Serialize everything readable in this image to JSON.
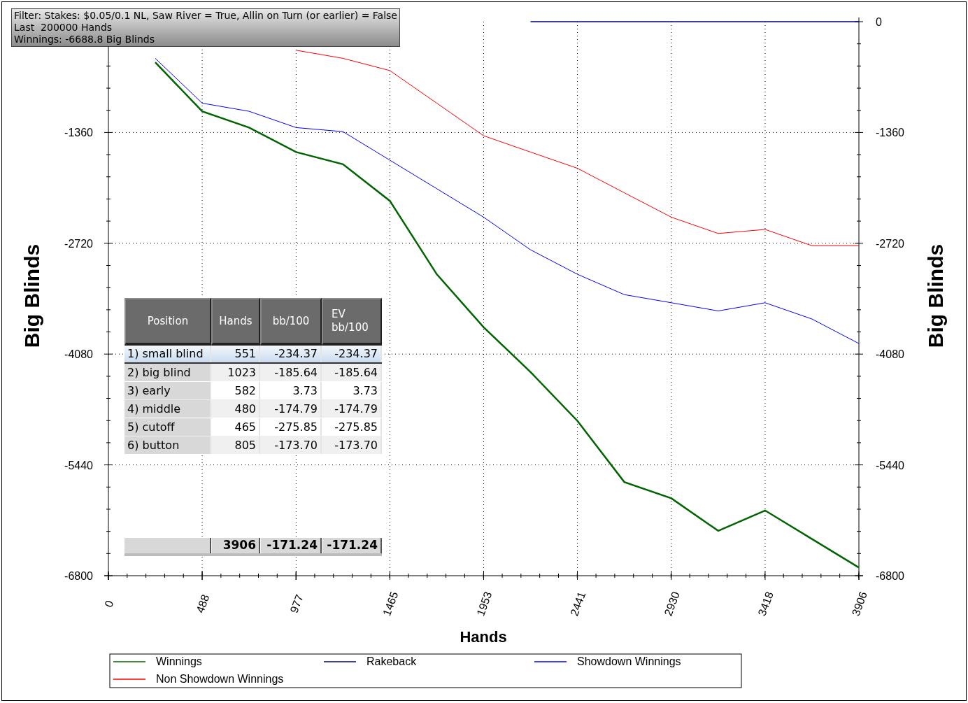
{
  "filter_box": {
    "lines": [
      "Filter: Stakes: $0.05/0.1 NL, Saw River = True, Allin on Turn (or earlier) = False",
      "Last  200000 Hands",
      "Winnings: -6688.8 Big Blinds"
    ]
  },
  "chart": {
    "ylabel_right": "Big Blinds",
    "left_axis_labels": [
      "-1360",
      "-2720",
      "-4080",
      "-5440",
      "-6800"
    ],
    "right_axis_labels": [
      "0",
      "-1360",
      "-2720",
      "-4080",
      "-5440",
      "-6800"
    ],
    "chart_data": {
      "type": "line",
      "xlabel": "Hands",
      "ylabel": "Big Blinds",
      "x": [
        244,
        488,
        732,
        977,
        1221,
        1465,
        1709,
        1953,
        2197,
        2441,
        2685,
        2930,
        3174,
        3418,
        3662,
        3906
      ],
      "xlim": [
        0,
        3906
      ],
      "ylim": [
        -6800,
        0
      ],
      "grid": true,
      "legend": true,
      "xticks": [
        0,
        488,
        977,
        1465,
        1953,
        2441,
        2930,
        3418,
        3906
      ],
      "yticks": [
        0,
        -1360,
        -2720,
        -4080,
        -5440,
        -6800
      ],
      "series": [
        {
          "name": "Winnings",
          "color": "#006400",
          "values": [
            -500,
            -1100,
            -1300,
            -1600,
            -1750,
            -2200,
            -3100,
            -3750,
            -4300,
            -4900,
            -5650,
            -5850,
            -6250,
            -6000,
            -6350,
            -6700
          ]
        },
        {
          "name": "Rakeback",
          "color": "#000080",
          "values": [
            null,
            null,
            null,
            null,
            null,
            null,
            null,
            null,
            0,
            0,
            0,
            0,
            0,
            0,
            0,
            0
          ]
        },
        {
          "name": "Showdown Winnings",
          "color": "#0000ff",
          "values": [
            -450,
            -1000,
            -1100,
            -1300,
            -1350,
            -1700,
            -2050,
            -2400,
            -2800,
            -3100,
            -3350,
            -3450,
            -3550,
            -3450,
            -3650,
            -3950
          ]
        },
        {
          "name": "Non Showdown Winnings",
          "color": "#ff0000",
          "values": [
            null,
            null,
            null,
            -350,
            -450,
            -600,
            -1000,
            -1400,
            -1600,
            -1800,
            -2100,
            -2400,
            -2600,
            -2550,
            -2750,
            -2750
          ]
        }
      ]
    }
  },
  "table": {
    "columns": [
      "Position",
      "Hands",
      "bb/100",
      "EV bb/100"
    ],
    "rows": [
      {
        "cells": [
          "1) small blind",
          "551",
          "-234.37",
          "-234.37"
        ],
        "selected": true
      },
      {
        "cells": [
          "2) big blind",
          "1023",
          "-185.64",
          "-185.64"
        ],
        "selected": false
      },
      {
        "cells": [
          "3) early",
          "582",
          "3.73",
          "3.73"
        ],
        "selected": false
      },
      {
        "cells": [
          "4) middle",
          "480",
          "-174.79",
          "-174.79"
        ],
        "selected": false
      },
      {
        "cells": [
          "5) cutoff",
          "465",
          "-275.85",
          "-275.85"
        ],
        "selected": false
      },
      {
        "cells": [
          "6) button",
          "805",
          "-173.70",
          "-173.70"
        ],
        "selected": false
      }
    ],
    "totals": [
      "3906",
      "-171.24",
      "-171.24"
    ]
  }
}
